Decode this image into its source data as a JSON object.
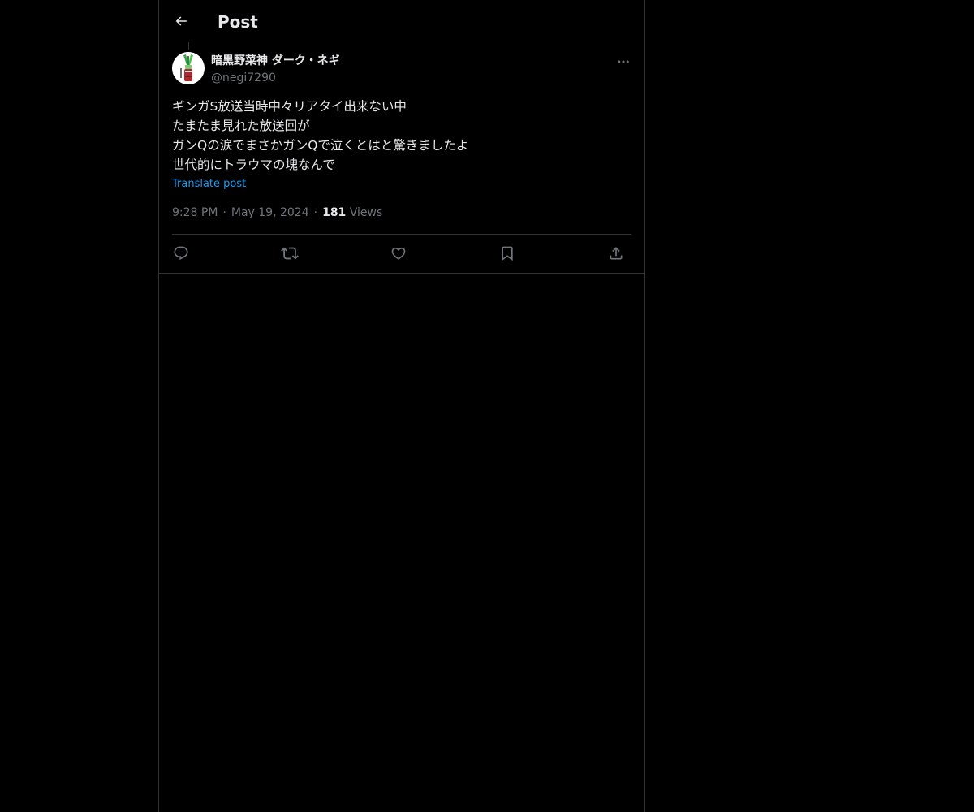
{
  "header": {
    "title": "Post",
    "back_icon": "arrow-left-icon"
  },
  "author": {
    "display_name": "暗黒野菜神 ダーク・ネギ",
    "handle": "@negi7290",
    "avatar_icon": "leek-avatar"
  },
  "post": {
    "lines": [
      "ギンガS放送当時中々リアタイ出来ない中",
      "たまたま見れた放送回が",
      "ガンQの涙でまさかガンQで泣くとはと驚きましたよ",
      "世代的にトラウマの塊なんで"
    ],
    "translate_label": "Translate post",
    "time": "9:28 PM",
    "date": "May 19, 2024",
    "views_count": "181",
    "views_label": "Views",
    "separator": "·"
  },
  "actions": [
    {
      "name": "reply",
      "icon": "reply-icon"
    },
    {
      "name": "repost",
      "icon": "repost-icon"
    },
    {
      "name": "like",
      "icon": "heart-icon"
    },
    {
      "name": "bookmark",
      "icon": "bookmark-icon"
    },
    {
      "name": "share",
      "icon": "share-icon"
    }
  ],
  "colors": {
    "background": "#000000",
    "text_primary": "#e7e9ea",
    "text_secondary": "#71767b",
    "link": "#1d9bf0",
    "border": "#2f3336"
  }
}
